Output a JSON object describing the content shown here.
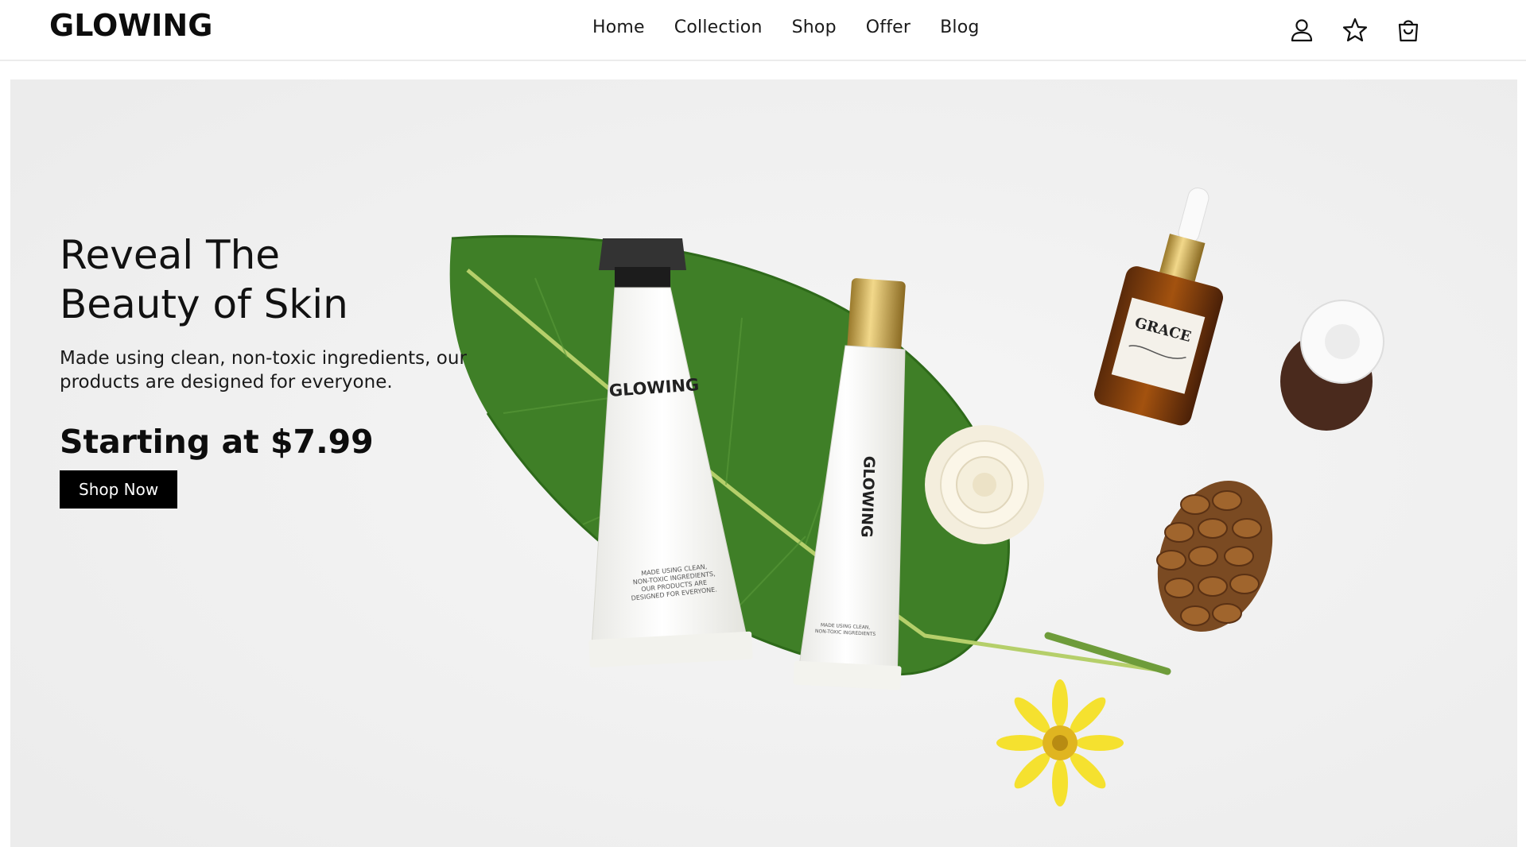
{
  "brand": {
    "logo": "GLOWING"
  },
  "nav": {
    "items": [
      {
        "label": "Home"
      },
      {
        "label": "Collection"
      },
      {
        "label": "Shop"
      },
      {
        "label": "Offer"
      },
      {
        "label": "Blog"
      }
    ]
  },
  "header_actions": {
    "account_icon": "user-icon",
    "wishlist_icon": "star-icon",
    "cart_icon": "shopping-bag-icon"
  },
  "hero": {
    "headline_line1": "Reveal The",
    "headline_line2": "Beauty of Skin",
    "description": "Made using clean, non-toxic ingredients, our products are designed for everyone.",
    "price_text": "Starting at $7.99",
    "cta_label": "Shop Now"
  },
  "product_image": {
    "tube_large_brand": "GLOWING",
    "tube_large_text": "MADE USING CLEAN, NON-TOXIC INGREDIENTS, OUR PRODUCTS ARE DESIGNED FOR EVERYONE.",
    "tube_small_brand": "GLOWING",
    "tube_small_text": "MADE USING CLEAN, NON-TOXIC INGREDIENTS",
    "bottle_label": "GRACE"
  },
  "colors": {
    "hero_bg": "#f0f0f0",
    "button_bg": "#000000",
    "leaf": "#3f7f27",
    "flower": "#f5e12f"
  }
}
